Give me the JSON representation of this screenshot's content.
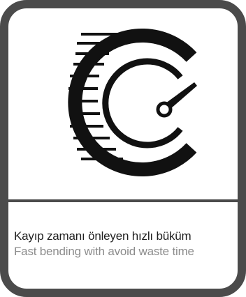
{
  "card": {
    "icon": "speedometer-speed-icon",
    "caption_tr": "Kayıp zamanı önleyen hızlı büküm",
    "caption_en": "Fast bending with avoid waste time"
  },
  "colors": {
    "frame": "#4b4b4b",
    "icon": "#111111",
    "text_primary": "#1f1f1f",
    "text_secondary": "#8c8c8c"
  }
}
